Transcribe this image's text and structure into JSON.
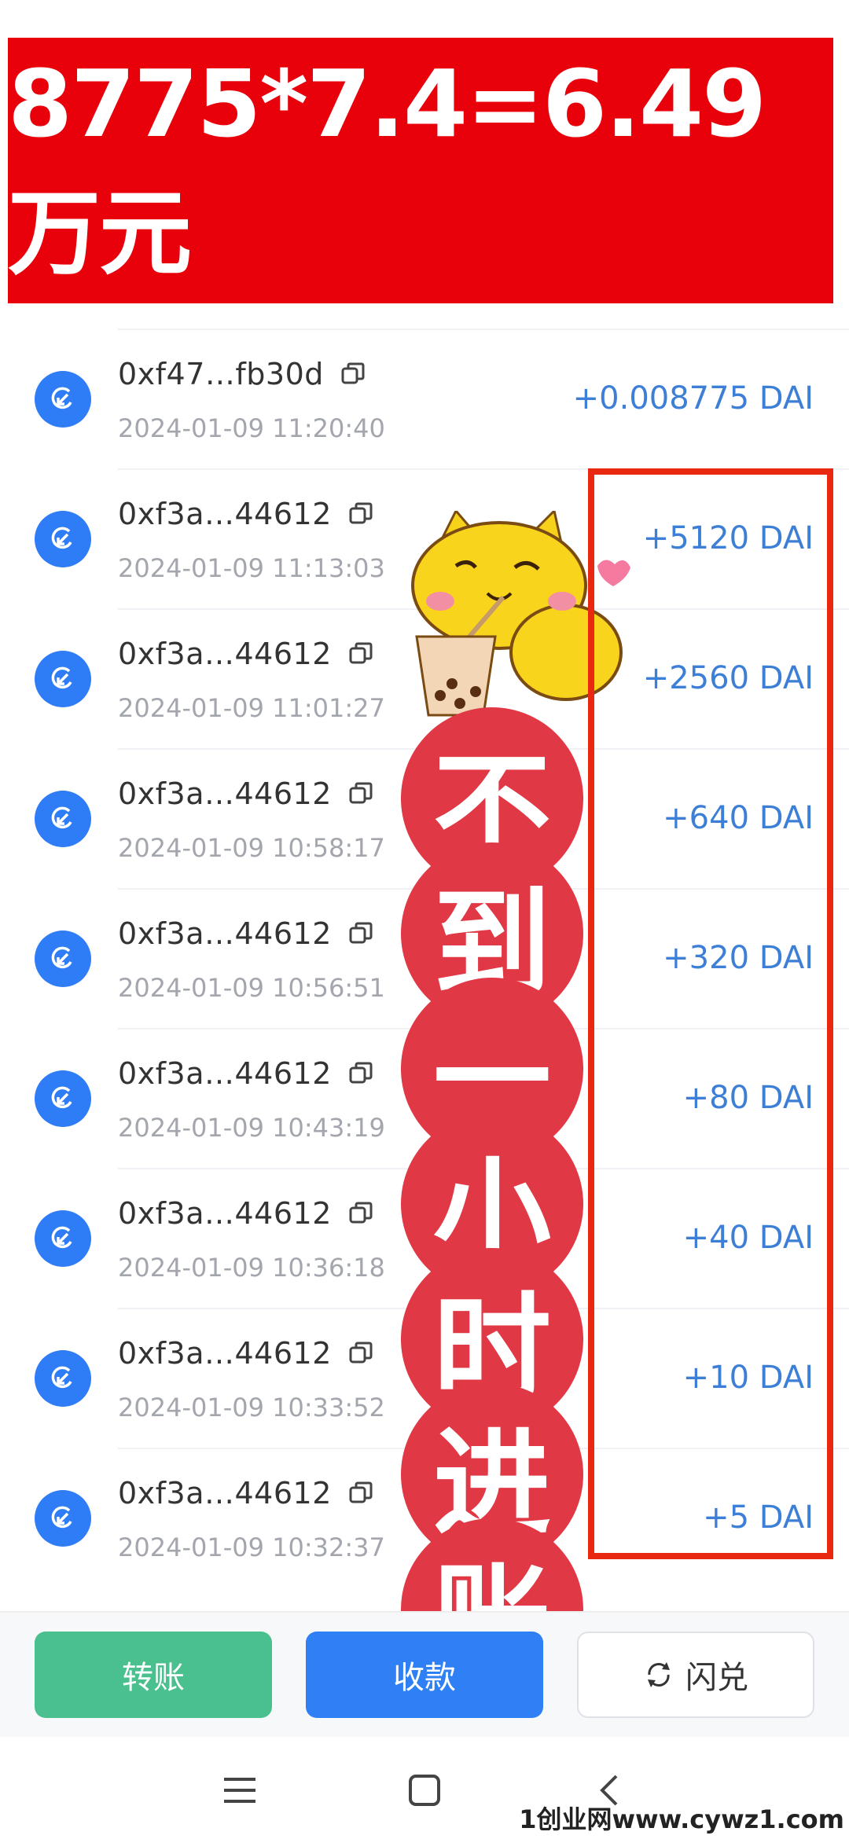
{
  "banner": {
    "text": "8775*7.4=6.49万元"
  },
  "transactions": [
    {
      "address": "0xf47…fb30d",
      "time": "2024-01-09 11:20:40",
      "amount": "+0.008775 DAI"
    },
    {
      "address": "0xf3a…44612",
      "time": "2024-01-09 11:13:03",
      "amount": "+5120 DAI"
    },
    {
      "address": "0xf3a…44612",
      "time": "2024-01-09 11:01:27",
      "amount": "+2560 DAI"
    },
    {
      "address": "0xf3a…44612",
      "time": "2024-01-09 10:58:17",
      "amount": "+640 DAI"
    },
    {
      "address": "0xf3a…44612",
      "time": "2024-01-09 10:56:51",
      "amount": "+320 DAI"
    },
    {
      "address": "0xf3a…44612",
      "time": "2024-01-09 10:43:19",
      "amount": "+80 DAI"
    },
    {
      "address": "0xf3a…44612",
      "time": "2024-01-09 10:36:18",
      "amount": "+40 DAI"
    },
    {
      "address": "0xf3a…44612",
      "time": "2024-01-09 10:33:52",
      "amount": "+10 DAI"
    },
    {
      "address": "0xf3a…44612",
      "time": "2024-01-09 10:32:37",
      "amount": "+5 DAI"
    }
  ],
  "overlay": {
    "characters": [
      "不",
      "到",
      "一",
      "小",
      "时",
      "进",
      "账"
    ]
  },
  "actions": {
    "transfer": "转账",
    "receive": "收款",
    "swap": "闪兑"
  },
  "icons": {
    "tx": "receive-icon",
    "copy": "copy-icon",
    "swap": "swap-icon"
  },
  "colors": {
    "banner": "#e8000b",
    "accent": "#2f80f4",
    "transfer": "#49c08e",
    "amount": "#3d7fd6",
    "stamp": "#e13845"
  },
  "watermark": "1创业网www.cywz1.com"
}
